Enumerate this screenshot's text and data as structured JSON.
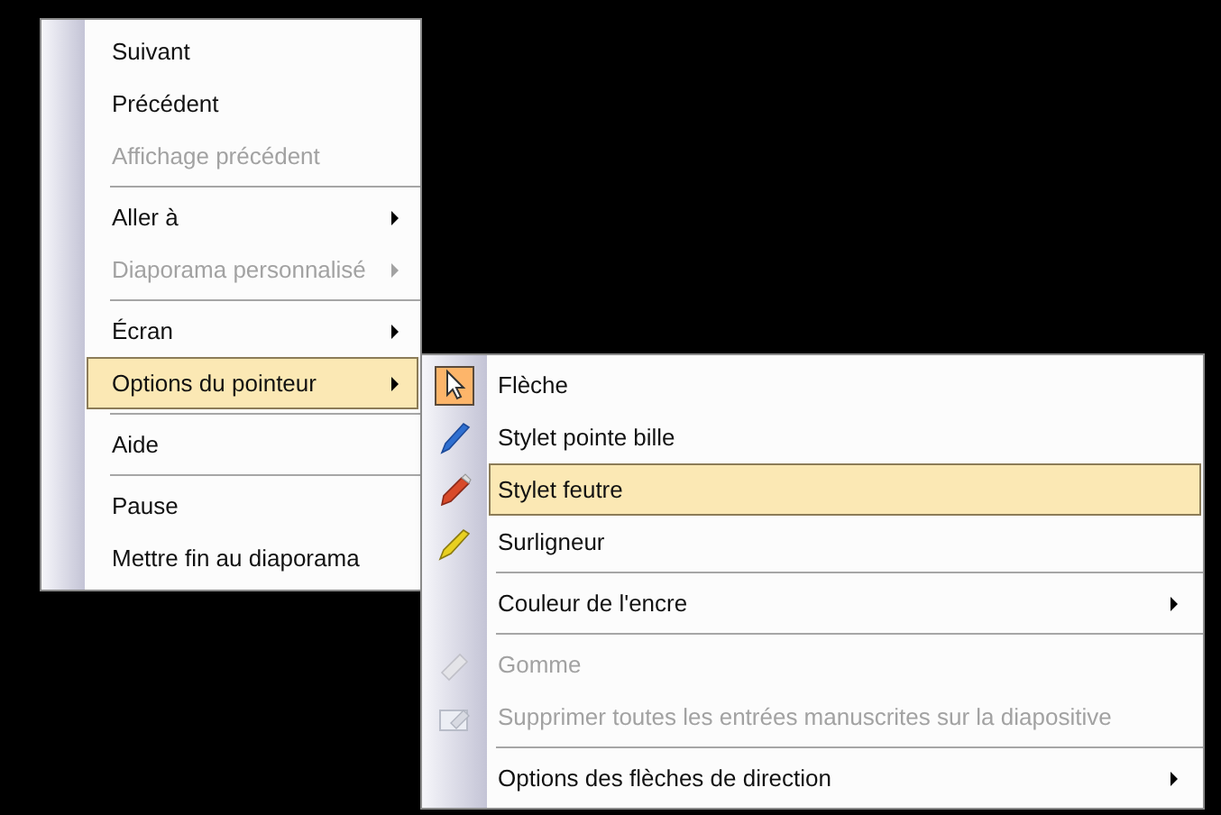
{
  "menus": [
    {
      "items": [
        {
          "kind": "item",
          "label": "Suivant",
          "disabled": false,
          "highlighted": false,
          "submenu": false
        },
        {
          "kind": "item",
          "label": "Précédent",
          "disabled": false,
          "highlighted": false,
          "submenu": false
        },
        {
          "kind": "item",
          "label": "Affichage précédent",
          "disabled": true,
          "highlighted": false,
          "submenu": false
        },
        {
          "kind": "separator"
        },
        {
          "kind": "item",
          "label": "Aller à",
          "disabled": false,
          "highlighted": false,
          "submenu": true
        },
        {
          "kind": "item",
          "label": "Diaporama personnalisé",
          "disabled": true,
          "highlighted": false,
          "submenu": true
        },
        {
          "kind": "separator"
        },
        {
          "kind": "item",
          "label": "Écran",
          "disabled": false,
          "highlighted": false,
          "submenu": true
        },
        {
          "kind": "item",
          "label": "Options du pointeur",
          "disabled": false,
          "highlighted": true,
          "submenu": true
        },
        {
          "kind": "separator"
        },
        {
          "kind": "item",
          "label": "Aide",
          "disabled": false,
          "highlighted": false,
          "submenu": false
        },
        {
          "kind": "separator"
        },
        {
          "kind": "item",
          "label": "Pause",
          "disabled": false,
          "highlighted": false,
          "submenu": false
        },
        {
          "kind": "item",
          "label": "Mettre fin au diaporama",
          "disabled": false,
          "highlighted": false,
          "submenu": false
        }
      ]
    },
    {
      "items": [
        {
          "kind": "item",
          "label": "Flèche",
          "disabled": false,
          "highlighted": false,
          "submenu": false,
          "checked": true
        },
        {
          "kind": "item",
          "label": "Stylet pointe bille",
          "disabled": false,
          "highlighted": false,
          "submenu": false,
          "checked": false
        },
        {
          "kind": "item",
          "label": "Stylet feutre",
          "disabled": false,
          "highlighted": true,
          "submenu": false,
          "checked": false
        },
        {
          "kind": "item",
          "label": "Surligneur",
          "disabled": false,
          "highlighted": false,
          "submenu": false,
          "checked": false
        },
        {
          "kind": "separator"
        },
        {
          "kind": "item",
          "label": "Couleur de l'encre",
          "disabled": false,
          "highlighted": false,
          "submenu": true
        },
        {
          "kind": "separator"
        },
        {
          "kind": "item",
          "label": "Gomme",
          "disabled": true,
          "highlighted": false,
          "submenu": false
        },
        {
          "kind": "item",
          "label": "Supprimer toutes les entrées manuscrites sur la diapositive",
          "disabled": true,
          "highlighted": false,
          "submenu": false
        },
        {
          "kind": "separator"
        },
        {
          "kind": "item",
          "label": "Options des flèches de direction",
          "disabled": false,
          "highlighted": false,
          "submenu": true
        }
      ]
    }
  ]
}
